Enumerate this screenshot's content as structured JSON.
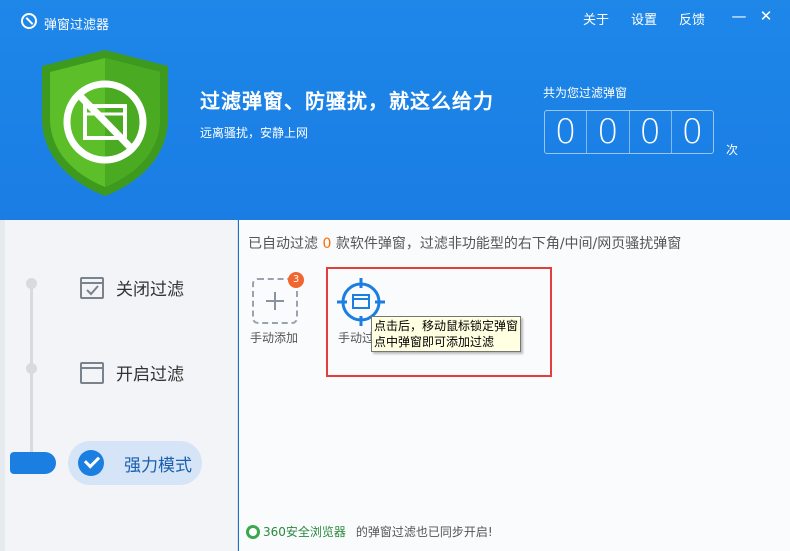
{
  "window": {
    "title": "弹窗过滤器"
  },
  "top_menu": {
    "about": "关于",
    "settings": "设置",
    "feedback": "反馈"
  },
  "controls": {
    "minimize": "—",
    "close": "✕"
  },
  "header": {
    "headline": "过滤弹窗、防骚扰，就这么给力",
    "subline": "远离骚扰，安静上网",
    "counter_label": "共为您过滤弹窗",
    "digits": [
      "0",
      "0",
      "0",
      "0"
    ],
    "counter_unit": "次"
  },
  "modes": {
    "off_label": "关闭过滤",
    "on_label": "开启过滤",
    "strong_label": "强力模式",
    "active": "strong"
  },
  "info": {
    "prefix": "已自动过滤 ",
    "count": "0",
    "suffix": " 款软件弹窗，过滤非功能型的右下角/中间/网页骚扰弹窗"
  },
  "tiles": {
    "manual_add_label": "手动添加",
    "manual_add_badge": "3",
    "manual_filter_label": "手动过"
  },
  "tooltip": {
    "line1": "点击后，移动鼠标锁定弹窗",
    "line2": "点中弹窗即可添加过滤"
  },
  "footer": {
    "browser_name": "360安全浏览器",
    "text": "的弹窗过滤也已同步开启!"
  },
  "colors": {
    "accent": "#1a7fe0",
    "header_bg": "#1e87e8",
    "highlight": "#ff6a00",
    "frame": "#e43d3d",
    "shield": "#5cbf2a"
  }
}
